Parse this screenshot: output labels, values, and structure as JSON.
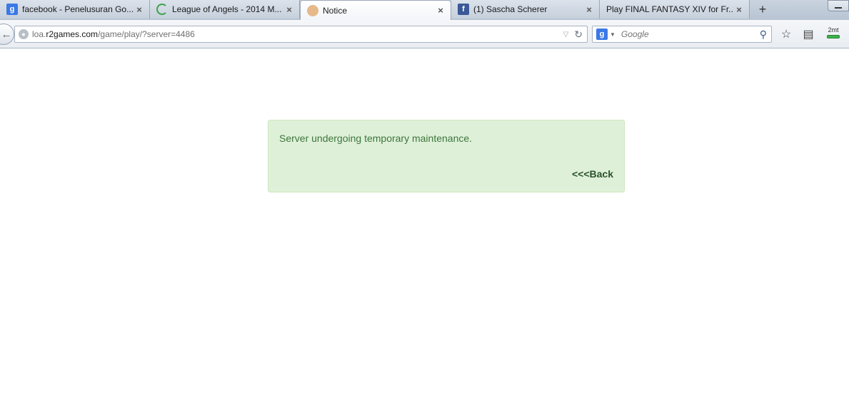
{
  "tabs": [
    {
      "title": "facebook - Penelusuran Go...",
      "favicon": "google-icon",
      "active": false
    },
    {
      "title": "League of Angels - 2014 M...",
      "favicon": "loading-spinner-icon",
      "active": false
    },
    {
      "title": "Notice",
      "favicon": "notice-avatar-icon",
      "active": true
    },
    {
      "title": "(1) Sascha Scherer",
      "favicon": "facebook-icon",
      "active": false
    },
    {
      "title": "Play FINAL FANTASY XIV for Fr...",
      "favicon": "none",
      "active": false
    }
  ],
  "favicon_glyphs": {
    "google": "g",
    "facebook": "f"
  },
  "newtab_glyph": "+",
  "close_glyph": "×",
  "navbar": {
    "url_prefix": "loa.",
    "url_domain": "r2games.com",
    "url_path": "/game/play/?server=4486",
    "search_placeholder": "Google",
    "addon_label": "2mt"
  },
  "alert": {
    "message": "Server undergoing temporary maintenance.",
    "back_link": "<<<Back",
    "background": "#dff0d8",
    "text_color": "#3c763d"
  }
}
